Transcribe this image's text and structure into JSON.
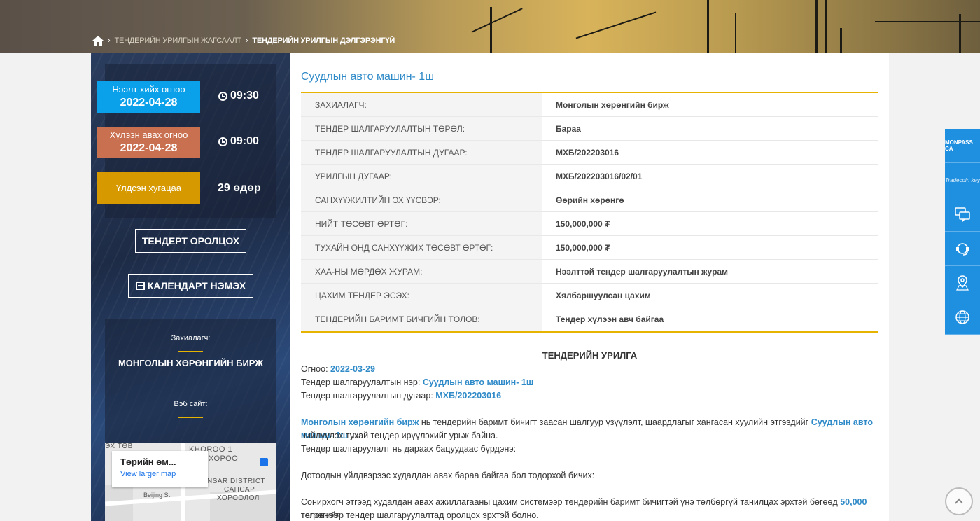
{
  "breadcrumb": {
    "parent": "ТЕНДЕРИЙН УРИЛГЫН ЖАГСААЛТ",
    "current": "ТЕНДЕРИЙН УРИЛГЫН ДЭЛГЭРЭНГҮЙ"
  },
  "schedule": {
    "open_label": "Нээлт хийх огноо",
    "open_date": "2022-04-28",
    "open_time": "09:30",
    "receive_label": "Хүлээн авах огноо",
    "receive_date": "2022-04-28",
    "receive_time": "09:00",
    "remaining_label": "Үлдсэн хугацаа",
    "remaining_value": "29 өдөр"
  },
  "actions": {
    "participate": "ТЕНДЕРТ ОРОЛЦОХ",
    "calendar": "КАЛЕНДАРТ НЭМЭХ"
  },
  "client": {
    "label": "Захиалагч:",
    "value": "МОНГОЛЫН ХӨРӨНГИЙН БИРЖ"
  },
  "website": {
    "label": "Вэб сайт:"
  },
  "map": {
    "place": "Төрийн өм...",
    "link": "View larger map",
    "labels": [
      "ЭХ ТӨВ",
      "KHOROO 1",
      "ХОРОО",
      "NSAR DISTRICT",
      "САНСАР",
      "ХОРООЛОЛ",
      "Beijing St"
    ]
  },
  "tender": {
    "title": "Суудлын авто машин- 1ш",
    "rows": [
      {
        "k": "ЗАХИАЛАГЧ:",
        "v": "Монголын хөрөнгийн бирж"
      },
      {
        "k": "ТЕНДЕР ШАЛГАРУУЛАЛТЫН ТӨРӨЛ:",
        "v": "Бараа"
      },
      {
        "k": "ТЕНДЕР ШАЛГАРУУЛАЛТЫН ДУГААР:",
        "v": "МХБ/202203016"
      },
      {
        "k": "УРИЛГЫН ДУГААР:",
        "v": "МХБ/202203016/02/01"
      },
      {
        "k": "САНХҮҮЖИЛТИЙН ЭХ ҮҮСВЭР:",
        "v": "Өөрийн хөрөнгө"
      },
      {
        "k": "НИЙТ ТӨСӨВТ ӨРТӨГ:",
        "v": "150,000,000 ₮"
      },
      {
        "k": "ТУХАЙН ОНД САНХҮҮЖИХ ТӨСӨВТ ӨРТӨГ:",
        "v": "150,000,000 ₮"
      },
      {
        "k": "ХАА-НЫ МӨРДӨХ ЖУРАМ:",
        "v": "Нээлттэй тендер шалгаруулалтын журам"
      },
      {
        "k": "ЦАХИМ ТЕНДЕР ЭСЭХ:",
        "v": "Хялбаршуулсан цахим"
      },
      {
        "k": "ТЕНДЕРИЙН БАРИМТ БИЧГИЙН ТӨЛӨВ:",
        "v": "Тендер хүлээн авч байгаа"
      }
    ]
  },
  "invitation": {
    "heading": "ТЕНДЕРИЙН УРИЛГА",
    "date_label": "Огноо: ",
    "date_value": "2022-03-29",
    "name_label": "Тендер шалгаруулалтын нэр: ",
    "name_value": "Суудлын авто машин- 1ш",
    "number_label": "Тендер шалгаруулалтын дугаар: ",
    "number_value": "МХБ/202203016",
    "p1_client": "Монголын хөрөнгийн бирж",
    "p1_mid": " нь тендерийн баримт бичигт заасан шалгуур үзүүлэлт, шаардлагыг хангасан хуулийн этгээдийг ",
    "p1_item": "Суудлын авто машин- 1ш",
    "p1_end": "–ыг",
    "p1_line2": "нийлүүлэх тухай тендер ирүүлэхийг урьж байна.",
    "p2": "Тендер шалгаруулалт нь дараах бацуудаас бүрдэнэ:",
    "p3": "Дотоодын үйлдвэрээс худалдан авах бараа байгаа бол тодорхой бичих:",
    "p4_start": "Сонирхогч этгээд худалдан авах ажиллагааны цахим системээр тендерийн баримт бичигтэй үнэ төлбөргүй танилцах эрхтэй бөгөөд ",
    "p4_amount": "50,000",
    "p4_end": " төгрөгийг",
    "p4_line2": "төлсөнөөр тендер шалгаруулалтад оролцох эрхтэй болно."
  },
  "sidebar_icons": [
    "monpass-icon",
    "tradecoin-icon",
    "chat-icon",
    "support-icon",
    "location-icon",
    "globe-icon"
  ],
  "sidebar_texts": {
    "monpass": "MONPASS CA",
    "tradecoin": "Tradecoin key"
  }
}
